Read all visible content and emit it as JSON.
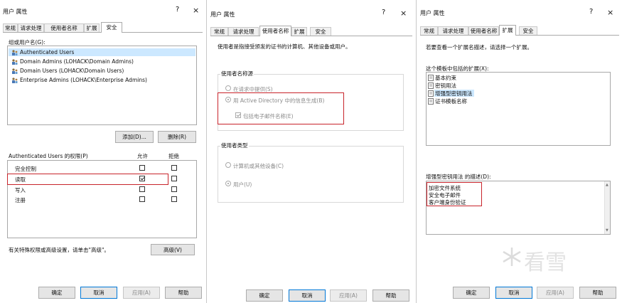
{
  "d1": {
    "title": "用户 属性",
    "help": "?",
    "close": "×",
    "tabs": [
      "常规",
      "请求处理",
      "使用者名称",
      "扩展",
      "安全"
    ],
    "groups_label": "组或用户名(G):",
    "principals": [
      "Authenticated Users",
      "Domain Admins (LOHACK\\Domain Admins)",
      "Domain Users (LOHACK\\Domain Users)",
      "Enterprise Admins (LOHACK\\Enterprise Admins)"
    ],
    "add_button": "添加(D)...",
    "remove_button": "删除(R)",
    "perm_label": "Authenticated Users 的权限(P)",
    "allow_header": "允许",
    "deny_header": "拒绝",
    "permissions": [
      {
        "name": "完全控制",
        "allow": false,
        "deny": false
      },
      {
        "name": "读取",
        "allow": true,
        "deny": false
      },
      {
        "name": "写入",
        "allow": false,
        "deny": false
      },
      {
        "name": "注册",
        "allow": false,
        "deny": false
      }
    ],
    "special_text": "有关特殊权限或高级设置，请单击\"高级\"。",
    "advanced_button": "高级(V)",
    "ok": "确定",
    "cancel": "取消",
    "apply": "应用(A)",
    "help_btn": "帮助"
  },
  "d2": {
    "title": "用户 属性",
    "help": "?",
    "close": "×",
    "tabs": [
      "常规",
      "请求处理",
      "使用者名称",
      "扩展",
      "安全"
    ],
    "description": "使用者是指接受颁发的证书的计算机、其他设备或用户。",
    "subject_group": "使用者名称源",
    "opt_supply": "在请求中提供(S)",
    "opt_ad": "用 Active Directory 中的信息生成(B)",
    "opt_email": "包括电子邮件名称(E)",
    "type_group": "使用者类型",
    "opt_computer": "计算机或其他设备(C)",
    "opt_user": "用户(U)",
    "ok": "确定",
    "cancel": "取消",
    "apply": "应用(A)",
    "help_btn": "帮助"
  },
  "d3": {
    "title": "用户 属性",
    "help": "?",
    "close": "×",
    "tabs": [
      "常规",
      "请求处理",
      "使用者名称",
      "扩展",
      "安全"
    ],
    "description": "若要查看一个扩展名描述，请选择一个扩展。",
    "ext_label": "这个模板中包括的扩展(X):",
    "extensions": [
      "基本约束",
      "密钥用法",
      "增强型密钥用法",
      "证书模板名称"
    ],
    "desc_label": "增强型密钥用法 的描述(D):",
    "desc_lines": [
      "加密文件系统",
      "安全电子邮件",
      "客户端身份验证"
    ],
    "ok": "确定",
    "cancel": "取消",
    "apply": "应用(A)",
    "help_btn": "帮助"
  },
  "watermark": "看雪"
}
